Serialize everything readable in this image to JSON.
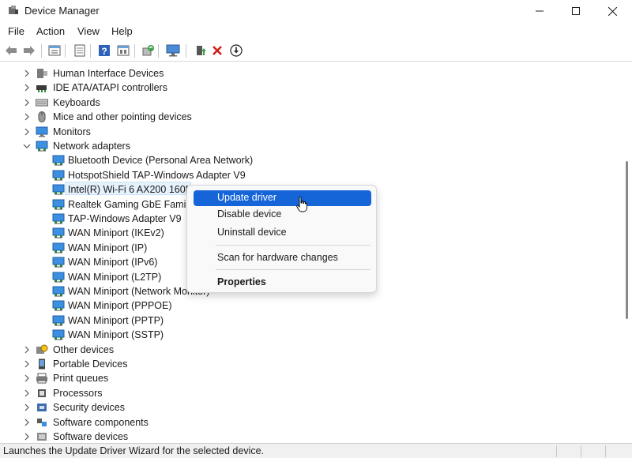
{
  "window": {
    "title": "Device Manager",
    "minimize_glyph": "—",
    "maximize_glyph": "☐",
    "close_glyph": "✕"
  },
  "menu": [
    {
      "label": "File"
    },
    {
      "label": "Action"
    },
    {
      "label": "View"
    },
    {
      "label": "Help"
    }
  ],
  "toolbar": {
    "icons": [
      "back-icon",
      "forward-icon",
      "properties-icon",
      "scan-view-icon",
      "help-icon",
      "resources-icon",
      "update-driver-icon",
      "monitor-icon",
      "add-driver-icon",
      "uninstall-icon",
      "download-icon"
    ]
  },
  "tree": {
    "categories_top": [
      {
        "label": "Human Interface Devices",
        "icon": "hid-icon",
        "expanded": false
      },
      {
        "label": "IDE ATA/ATAPI controllers",
        "icon": "ide-controller-icon",
        "expanded": false
      },
      {
        "label": "Keyboards",
        "icon": "keyboard-icon",
        "expanded": false
      },
      {
        "label": "Mice and other pointing devices",
        "icon": "mouse-icon",
        "expanded": false
      },
      {
        "label": "Monitors",
        "icon": "monitor-icon",
        "expanded": false
      },
      {
        "label": "Network adapters",
        "icon": "network-adapter-icon",
        "expanded": true
      }
    ],
    "network_children": [
      {
        "label": "Bluetooth Device (Personal Area Network)"
      },
      {
        "label": "HotspotShield TAP-Windows Adapter V9"
      },
      {
        "label": "Intel(R) Wi-Fi 6 AX200 160MHz"
      },
      {
        "label": "Realtek Gaming GbE Family"
      },
      {
        "label": "TAP-Windows Adapter V9"
      },
      {
        "label": "WAN Miniport (IKEv2)"
      },
      {
        "label": "WAN Miniport (IP)"
      },
      {
        "label": "WAN Miniport (IPv6)"
      },
      {
        "label": "WAN Miniport (L2TP)"
      },
      {
        "label": "WAN Miniport (Network Monitor)"
      },
      {
        "label": "WAN Miniport (PPPOE)"
      },
      {
        "label": "WAN Miniport (PPTP)"
      },
      {
        "label": "WAN Miniport (SSTP)"
      }
    ],
    "categories_bottom": [
      {
        "label": "Other devices",
        "icon": "other-devices-icon"
      },
      {
        "label": "Portable Devices",
        "icon": "portable-devices-icon"
      },
      {
        "label": "Print queues",
        "icon": "printer-icon"
      },
      {
        "label": "Processors",
        "icon": "processor-icon"
      },
      {
        "label": "Security devices",
        "icon": "security-device-icon"
      },
      {
        "label": "Software components",
        "icon": "software-component-icon"
      },
      {
        "label": "Software devices",
        "icon": "software-device-icon"
      }
    ],
    "selected": "Intel(R) Wi-Fi 6 AX200 160MHz"
  },
  "context_menu": {
    "items": [
      {
        "label": "Update driver",
        "highlighted": true
      },
      {
        "label": "Disable device"
      },
      {
        "label": "Uninstall device"
      },
      {
        "label": "Scan for hardware changes"
      },
      {
        "label": "Properties",
        "bold": true
      }
    ]
  },
  "status": {
    "text": "Launches the Update Driver Wizard for the selected device."
  },
  "colors": {
    "highlight": "#1565d8",
    "selection_bg": "#e5f1fb",
    "network_icon": "#2b88d8"
  }
}
